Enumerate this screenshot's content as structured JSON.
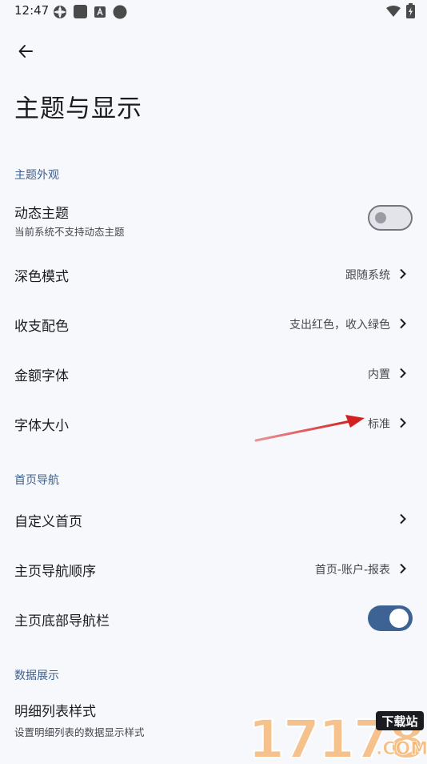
{
  "status_bar": {
    "time": "12:47"
  },
  "page": {
    "title": "主题与显示"
  },
  "sections": [
    {
      "header": "主题外观"
    },
    {
      "header": "首页导航"
    },
    {
      "header": "数据展示"
    }
  ],
  "rows": {
    "dynamic_theme": {
      "label": "动态主题",
      "sub": "当前系统不支持动态主题",
      "enabled": false
    },
    "dark_mode": {
      "label": "深色模式",
      "value": "跟随系统"
    },
    "income_color": {
      "label": "收支配色",
      "value": "支出红色，收入绿色"
    },
    "amount_font": {
      "label": "金额字体",
      "value": "内置"
    },
    "font_size": {
      "label": "字体大小",
      "value": "标准"
    },
    "custom_home": {
      "label": "自定义首页"
    },
    "nav_order": {
      "label": "主页导航顺序",
      "value": "首页-账户-报表"
    },
    "bottom_nav": {
      "label": "主页底部导航栏",
      "enabled": true
    },
    "detail_style": {
      "label": "明细列表样式",
      "sub": "设置明细列表的数据显示样式"
    }
  },
  "watermark": {
    "text": "17178",
    "badge": "下载站",
    "domain": ".COM"
  },
  "colors": {
    "accent": "#3d6394",
    "section_header": "#3f5f8e",
    "background": "#f7f8fc",
    "annotation_arrow": "#d42020"
  }
}
